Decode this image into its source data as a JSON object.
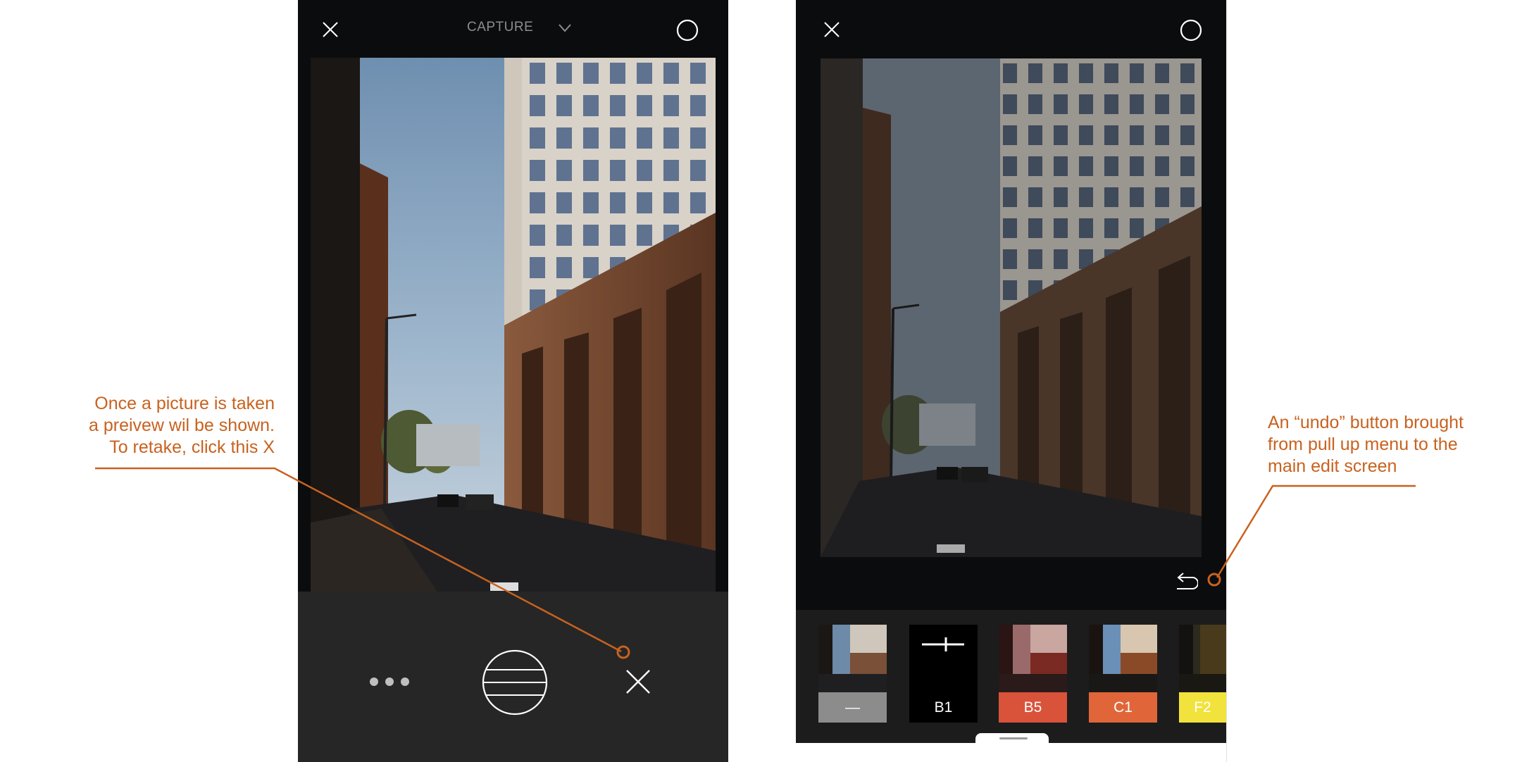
{
  "capture_screen": {
    "close_icon": "close-icon",
    "title": "CAPTURE",
    "dropdown_icon": "chevron-down-icon",
    "circle_icon": "circle-icon",
    "more_icon": "more-dots-icon",
    "shutter_icon": "shutter-lines-icon",
    "retake_icon": "close-icon"
  },
  "edit_screen": {
    "close_icon": "close-icon",
    "circle_icon": "circle-icon",
    "undo_icon": "undo-icon",
    "presets": [
      {
        "label": "—",
        "color": "#8c8c8c"
      },
      {
        "label": "B1",
        "color": "#000000"
      },
      {
        "label": "B5",
        "color": "#d9533a"
      },
      {
        "label": "C1",
        "color": "#e0663a"
      },
      {
        "label": "F2",
        "color": "#f2e23c"
      }
    ]
  },
  "annotations": {
    "left": {
      "line1": "Once a picture is taken",
      "line2": "a preivew wil be shown.",
      "line3": "To retake, click this X"
    },
    "right": {
      "line1": "An “undo” button brought",
      "line2": "from pull up menu to the",
      "line3": "main edit screen"
    },
    "color": "#c8621f"
  }
}
